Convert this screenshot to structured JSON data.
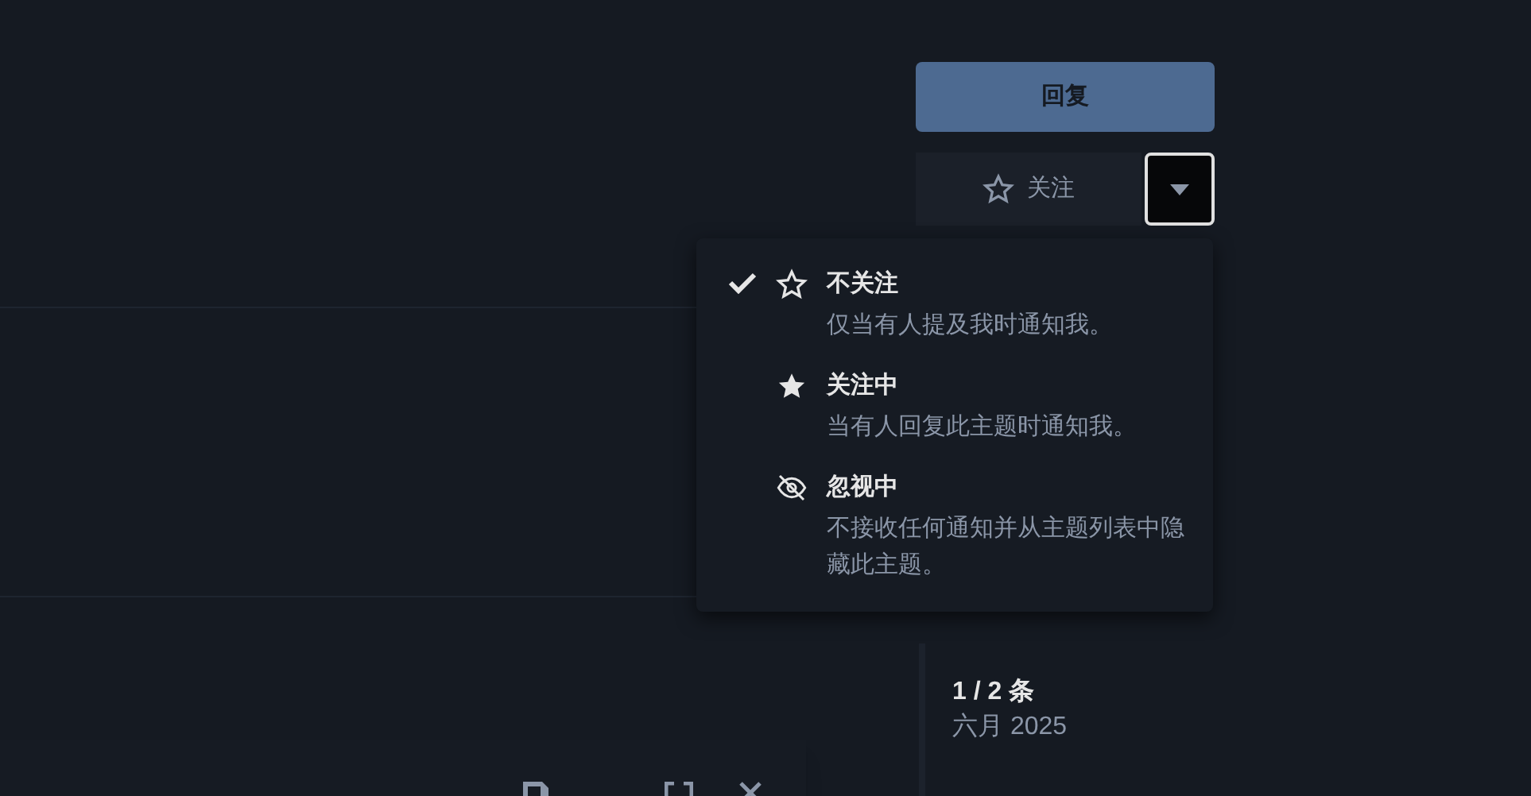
{
  "reply_button": {
    "label": "回复"
  },
  "notification_button": {
    "label": "关注"
  },
  "notification_menu": {
    "expanded": true,
    "items": [
      {
        "kind": "star-outline",
        "title": "不关注",
        "description": "仅当有人提及我时通知我。",
        "selected": true
      },
      {
        "kind": "star-filled",
        "title": "关注中",
        "description": "当有人回复此主题时通知我。",
        "selected": false
      },
      {
        "kind": "eye-slash",
        "title": "忽视中",
        "description": "不接收任何通知并从主题列表中隐藏此主题。",
        "selected": false
      }
    ]
  },
  "timeline": {
    "position": "1 / 2 条",
    "date": "六月 2025"
  }
}
